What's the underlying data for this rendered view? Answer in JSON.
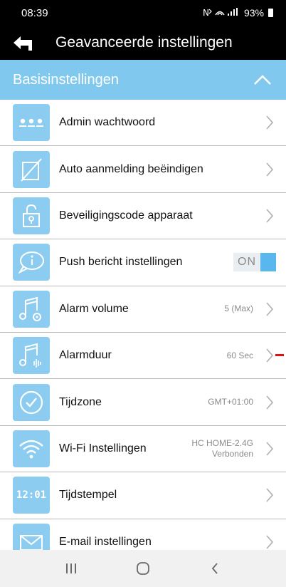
{
  "status_bar": {
    "time": "08:39",
    "signal": "ℕᵼ ≡ .∥",
    "battery": "93%"
  },
  "app_bar": {
    "title": "Geavanceerde instellingen"
  },
  "section": {
    "title": "Basisinstellingen"
  },
  "items": [
    {
      "label": "Admin wachtwoord",
      "icon": "dots-icon"
    },
    {
      "label": "Auto aanmelding beëindigen",
      "icon": "slashed-box-icon"
    },
    {
      "label": "Beveiligingscode apparaat",
      "icon": "lock-icon"
    },
    {
      "label": "Push bericht instellingen",
      "icon": "chat-info-icon",
      "toggle": "ON"
    },
    {
      "label": "Alarm volume",
      "icon": "music-gear-icon",
      "value": "5 (Max)"
    },
    {
      "label": "Alarmduur",
      "icon": "music-wave-icon",
      "value": "60 Sec"
    },
    {
      "label": "Tijdzone",
      "icon": "clock-check-icon",
      "value": "GMT+01:00"
    },
    {
      "label": "Wi-Fi Instellingen",
      "icon": "wifi-icon",
      "value": "HC HOME-2.4G",
      "value2": "Verbonden"
    },
    {
      "label": "Tijdstempel",
      "icon": "digital-clock-icon",
      "icon_text": "12:01"
    },
    {
      "label": "E-mail instellingen",
      "icon": "mail-icon"
    }
  ],
  "colors": {
    "accent": "#80c8ee",
    "icon_bg": "#8cccf0",
    "toggle": "#58b8ee",
    "bar": "#000000"
  }
}
